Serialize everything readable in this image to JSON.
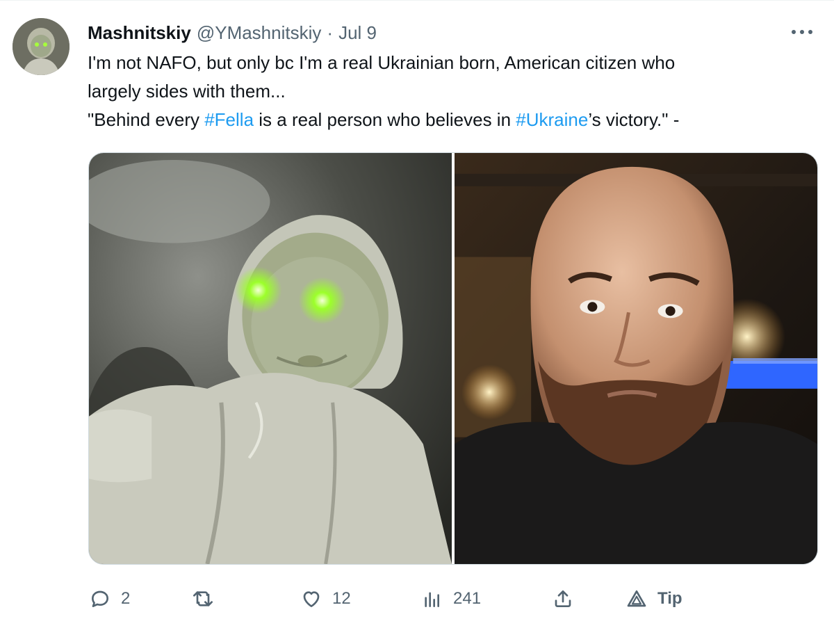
{
  "author": {
    "display_name": "Mashnitskiy",
    "handle": "@YMashnitskiy",
    "separator": "·",
    "date": "Jul 9",
    "avatar_icon": "avatar-baby-photo"
  },
  "tweet": {
    "text_line1": "I'm not NAFO, but only bc I'm a real Ukrainian born, American citizen who",
    "text_line2": "largely sides with them...",
    "quote_part1": "\"Behind every ",
    "hashtag1": "#Fella",
    "quote_part2": " is a real person who believes in ",
    "hashtag2": "#Ukraine",
    "quote_part3": "’s victory.\" -"
  },
  "media": {
    "photos": [
      {
        "icon": "baby-photo-green-eyes"
      },
      {
        "icon": "bearded-man-selfie"
      }
    ]
  },
  "actions": {
    "reply_count": "2",
    "retweet_count": "",
    "like_count": "12",
    "views_count": "241",
    "tip_label": "Tip"
  },
  "colors": {
    "text": "#0f1419",
    "secondary": "#536471",
    "link": "#1d9bf0",
    "background": "#ffffff"
  }
}
